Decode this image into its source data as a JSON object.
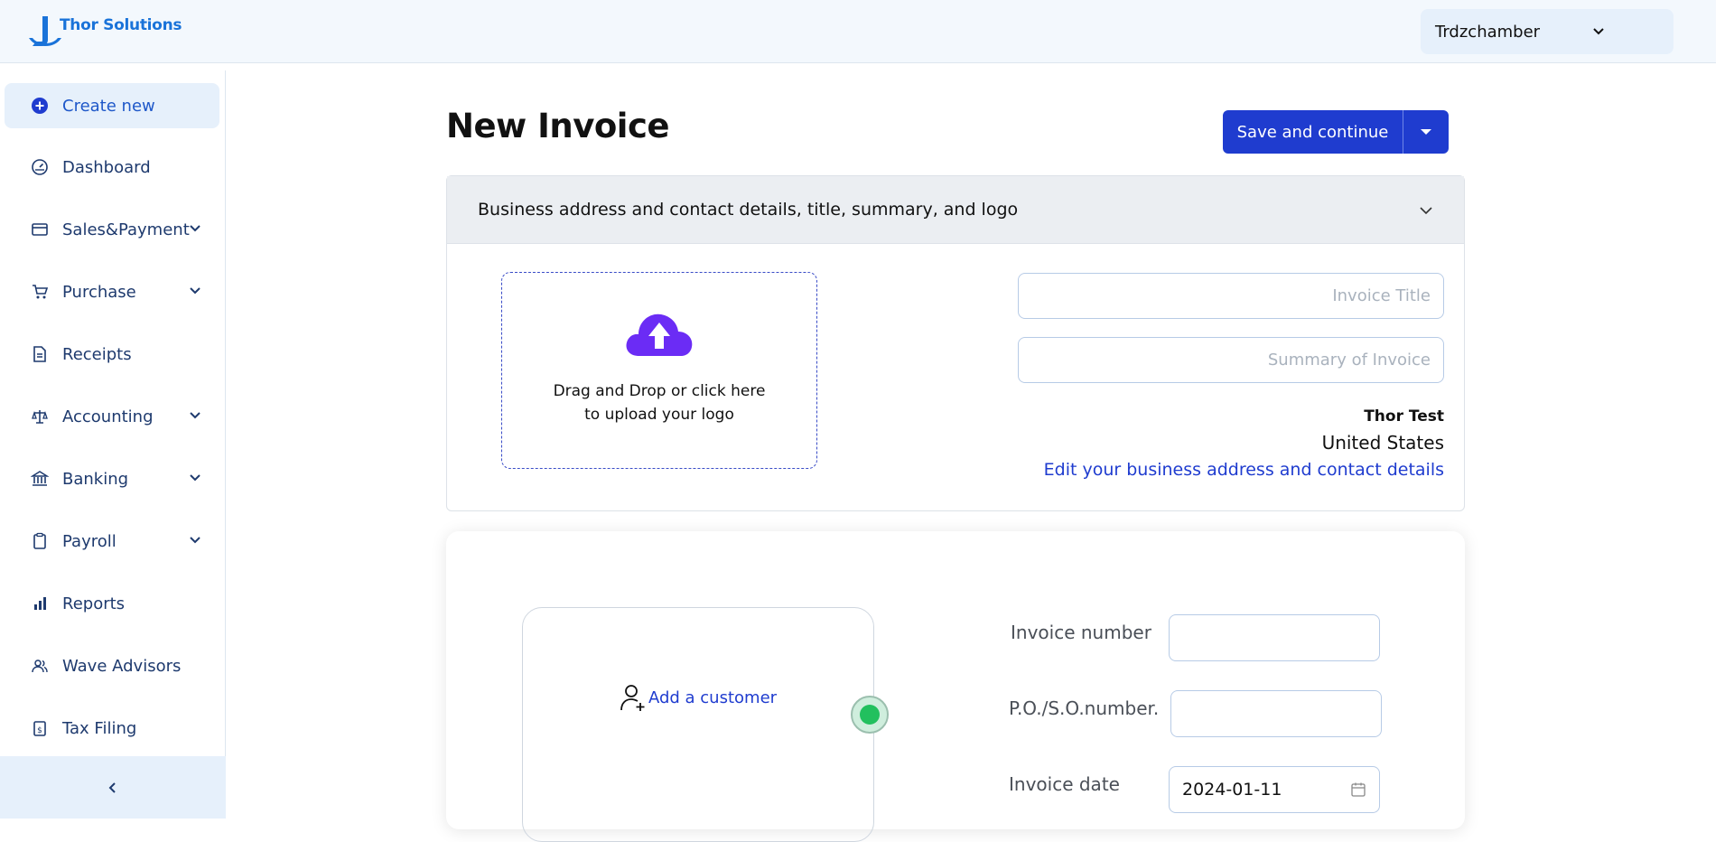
{
  "header": {
    "brand": "Thor Solutions",
    "org_name": "Trdzchamber"
  },
  "sidebar": {
    "items": [
      {
        "label": "Create new",
        "icon": "plus-circle-icon"
      },
      {
        "label": "Dashboard",
        "icon": "gauge-icon"
      },
      {
        "label": "Sales&Payment",
        "icon": "card-icon"
      },
      {
        "label": "Purchase",
        "icon": "cart-icon"
      },
      {
        "label": "Receipts",
        "icon": "receipt-icon"
      },
      {
        "label": "Accounting",
        "icon": "scale-icon"
      },
      {
        "label": "Banking",
        "icon": "bank-icon"
      },
      {
        "label": "Payroll",
        "icon": "clipboard-icon"
      },
      {
        "label": "Reports",
        "icon": "bar-chart-icon"
      },
      {
        "label": "Wave Advisors",
        "icon": "users-icon"
      },
      {
        "label": "Tax Filing",
        "icon": "tax-icon"
      }
    ]
  },
  "main": {
    "title": "New Invoice",
    "save_label": "Save and continue",
    "section_title": "Business address and contact details, title, summary, and logo",
    "upload_text_1": "Drag and Drop or click here",
    "upload_text_2": "to upload your logo",
    "invoice_title_placeholder": "Invoice Title",
    "summary_placeholder": "Summary of Invoice",
    "business_name": "Thor Test",
    "business_country": "United States",
    "edit_business_link": "Edit your business address and contact details",
    "add_customer": "Add a customer",
    "invoice_number_label": "Invoice number",
    "invoice_number_value": "",
    "po_label": "P.O./S.O.number.",
    "po_value": "",
    "invoice_date_label": "Invoice date",
    "invoice_date_value": "2024-01-11"
  },
  "colors": {
    "primary": "#1f3ccf",
    "sidebar_active_bg": "#e6f0fb",
    "upload_icon": "#6b2cf5",
    "status_green": "#22c05e"
  }
}
